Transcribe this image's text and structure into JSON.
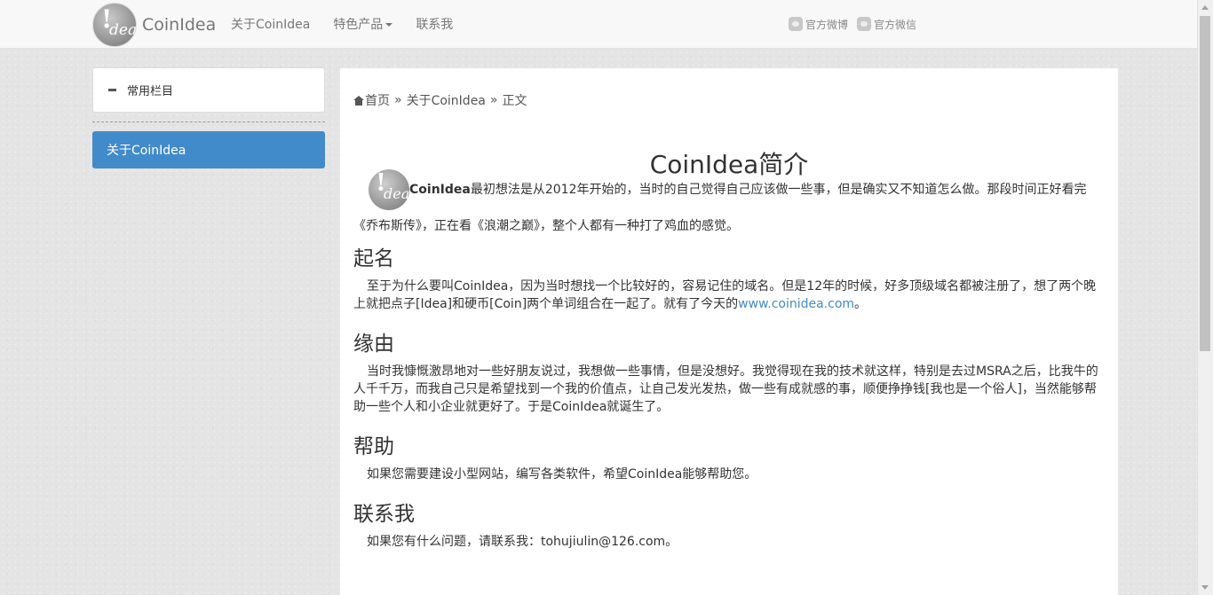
{
  "navbar": {
    "brand": "CoinIdea",
    "logo_text": {
      "bang": "!",
      "idea": "dea"
    },
    "links": [
      {
        "label": "关于CoinIdea"
      },
      {
        "label": "特色产品"
      },
      {
        "label": "联系我"
      }
    ],
    "social": [
      {
        "label": "官方微博",
        "icon": "weibo-icon"
      },
      {
        "label": "官方微信",
        "icon": "wechat-icon"
      }
    ]
  },
  "sidebar": {
    "panel_title": "常用栏目",
    "items": [
      {
        "label": "关于CoinIdea",
        "active": true
      }
    ],
    "active_color": "#428bca"
  },
  "breadcrumb": {
    "home": "首页",
    "sep": "»",
    "section": "关于CoinIdea",
    "current": "正文"
  },
  "article": {
    "title": "CoinIdea简介",
    "intro_brand": "CoinIdea",
    "intro_text": "最初想法是从2012年开始的，当时的自己觉得自己应该做一些事，但是确实又不知道怎么做。那段时间正好看完《乔布斯传》，正在看《浪潮之巅》，整个人都有一种打了鸡血的感觉。",
    "sections": [
      {
        "heading": "起名",
        "text": "至于为什么要叫CoinIdea，因为当时想找一个比较好的，容易记住的域名。但是12年的时候，好多顶级域名都被注册了，想了两个晚上就把点子[Idea]和硬币[Coin]两个单词组合在一起了。就有了今天的",
        "link": "www.coinidea.com",
        "suffix": "。"
      },
      {
        "heading": "缘由",
        "text": "当时我慷慨激昂地对一些好朋友说过，我想做一些事情，但是没想好。我觉得现在我的技术就这样，特别是去过MSRA之后，比我牛的人千千万，而我自己只是希望找到一个我的价值点，让自己发光发热，做一些有成就感的事，顺便挣挣钱[我也是一个俗人]，当然能够帮助一些个人和小企业就更好了。于是CoinIdea就诞生了。"
      },
      {
        "heading": "帮助",
        "text": "如果您需要建设小型网站，编写各类软件，希望CoinIdea能够帮助您。"
      },
      {
        "heading": "联系我",
        "text": "如果您有什么问题，请联系我：tohujiulin@126.com。"
      }
    ]
  }
}
